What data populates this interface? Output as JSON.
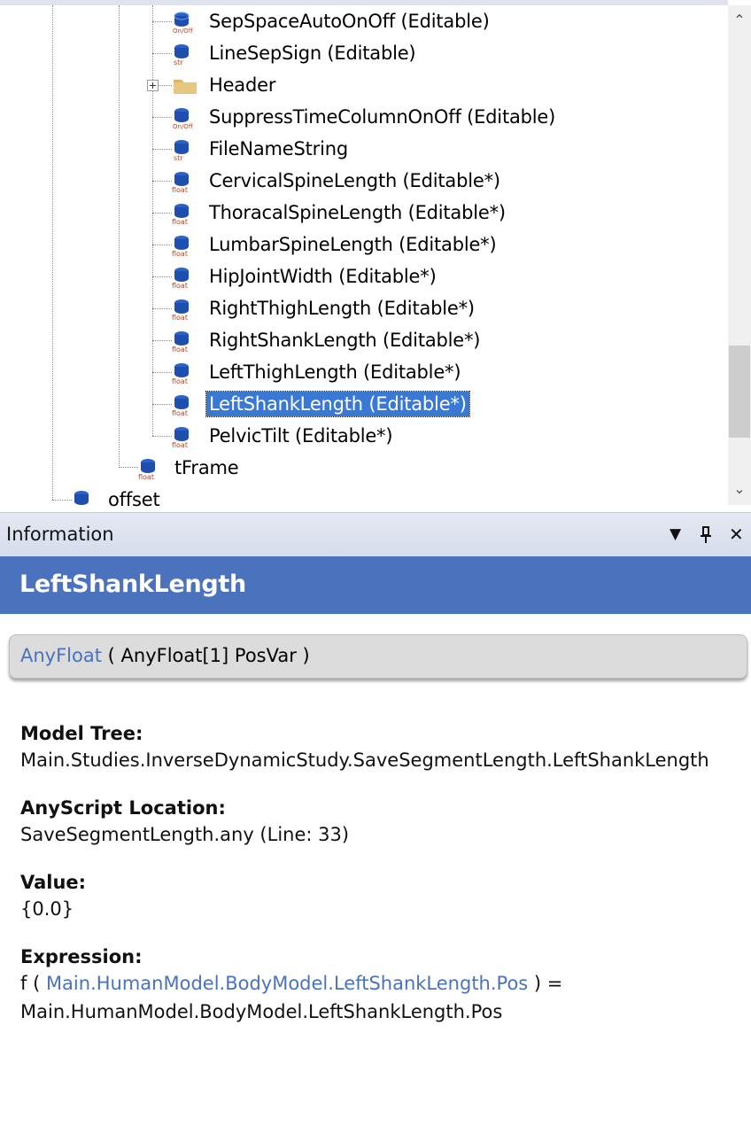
{
  "tree": {
    "folder_node": {
      "label": "Header"
    },
    "items": [
      {
        "label": "SepSpaceAutoOnOff (Editable)",
        "icon": "onoff-variable-icon",
        "badge": "On/Off"
      },
      {
        "label": "LineSepSign (Editable)",
        "icon": "str-variable-icon",
        "badge": "str"
      },
      {
        "label": "Header",
        "icon": "folder-icon",
        "badge": ""
      },
      {
        "label": "SuppressTimeColumnOnOff (Editable)",
        "icon": "onoff-variable-icon",
        "badge": "On/Off"
      },
      {
        "label": "FileNameString",
        "icon": "str-variable-icon",
        "badge": "str"
      },
      {
        "label": "CervicalSpineLength (Editable*)",
        "icon": "float-variable-icon",
        "badge": "float"
      },
      {
        "label": "ThoracalSpineLength (Editable*)",
        "icon": "float-variable-icon",
        "badge": "float"
      },
      {
        "label": "LumbarSpineLength (Editable*)",
        "icon": "float-variable-icon",
        "badge": "float"
      },
      {
        "label": "HipJointWidth (Editable*)",
        "icon": "float-variable-icon",
        "badge": "float"
      },
      {
        "label": "RightThighLength (Editable*)",
        "icon": "float-variable-icon",
        "badge": "float"
      },
      {
        "label": "RightShankLength (Editable*)",
        "icon": "float-variable-icon",
        "badge": "float"
      },
      {
        "label": "LeftThighLength (Editable*)",
        "icon": "float-variable-icon",
        "badge": "float"
      },
      {
        "label": "LeftShankLength (Editable*)",
        "icon": "float-variable-icon",
        "badge": "float",
        "selected": true
      },
      {
        "label": "PelvicTilt (Editable*)",
        "icon": "float-variable-icon",
        "badge": "float"
      },
      {
        "label": "tFrame",
        "icon": "float-variable-icon",
        "badge": "float"
      },
      {
        "label": "offset",
        "icon": "float-variable-icon",
        "badge": ""
      }
    ],
    "scroll_up_glyph": "⌃",
    "scroll_down_glyph": "⌄"
  },
  "info": {
    "header_title": "Information",
    "buttons": {
      "dropdown": "▼",
      "pin": "📌",
      "close": "✕"
    },
    "object_name": "LeftShankLength",
    "type_link": "AnyFloat",
    "type_rest": " ( AnyFloat[1] PosVar )",
    "model_tree_label": "Model Tree:",
    "model_tree_value": "Main.Studies.InverseDynamicStudy.SaveSegmentLength.LeftShankLength",
    "location_label": "AnyScript Location:",
    "location_value": "SaveSegmentLength.any (Line: 33)",
    "value_label": "Value:",
    "value_value": "{0.0}",
    "expression_label": "Expression:",
    "expression_prefix": "f ( ",
    "expression_arg": "Main.HumanModel.BodyModel.LeftShankLength.Pos",
    "expression_suffix": " ) =",
    "expression_result": "Main.HumanModel.BodyModel.LeftShankLength.Pos"
  },
  "colors": {
    "accent": "#4a72bd",
    "selection": "#3a78d6",
    "link": "#4a72bd"
  }
}
